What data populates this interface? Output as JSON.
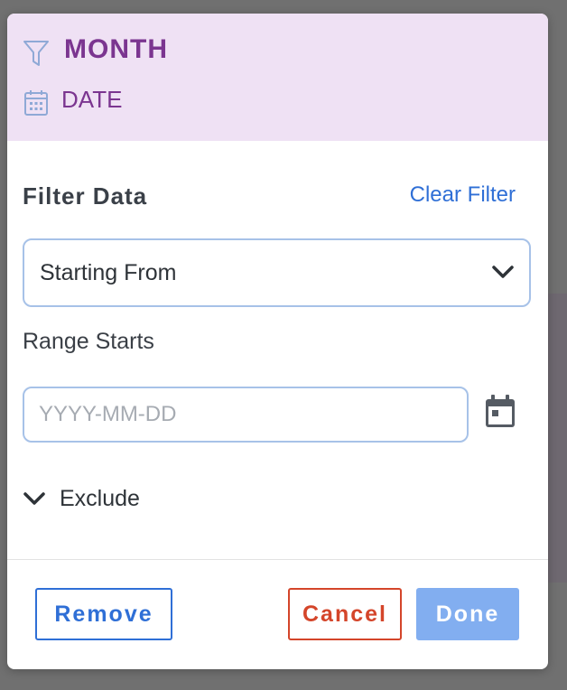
{
  "header": {
    "title": "MONTH",
    "subtitle": "DATE",
    "icons": {
      "title": "filter-icon",
      "subtitle": "calendar-icon"
    },
    "background_color": "#efe1f4",
    "text_color": "#7b3590"
  },
  "filter": {
    "section_title": "Filter Data",
    "clear_label": "Clear Filter",
    "operator_select": {
      "selected": "Starting From",
      "icon": "chevron-down-icon"
    },
    "range_label": "Range Starts",
    "date_input": {
      "value": "",
      "placeholder": "YYYY-MM-DD"
    },
    "calendar_button_icon": "calendar-icon",
    "exclude_label": "Exclude",
    "exclude_icon": "chevron-down-icon"
  },
  "footer": {
    "remove_label": "Remove",
    "cancel_label": "Cancel",
    "done_label": "Done"
  },
  "colors": {
    "accent_blue": "#2f6fd6",
    "cancel_red": "#d4452a",
    "done_disabled": "#82aef0"
  }
}
